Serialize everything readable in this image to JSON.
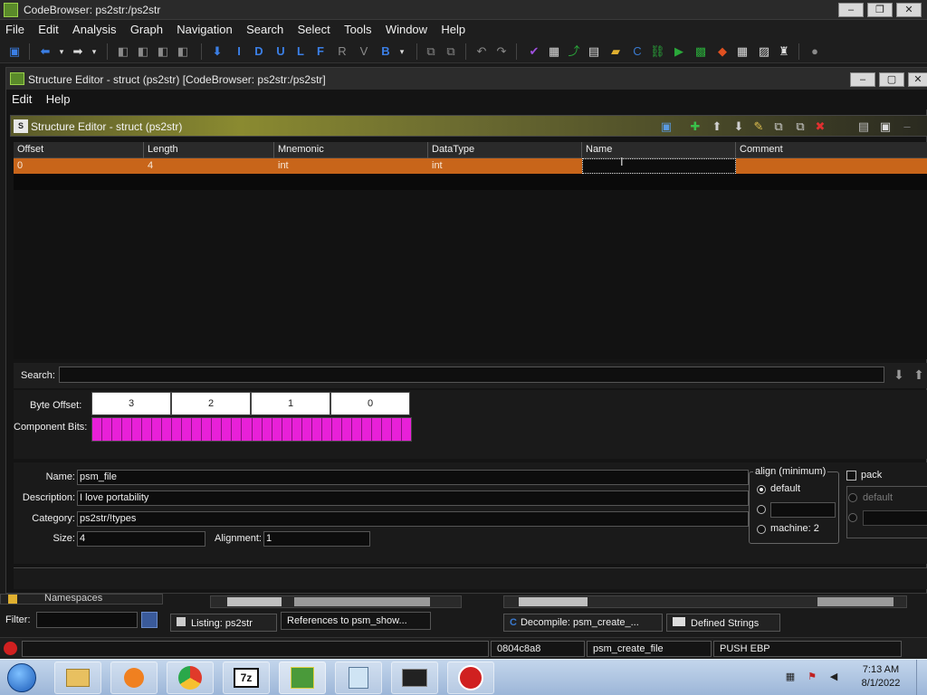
{
  "main_window": {
    "title": "CodeBrowser: ps2str:/ps2str",
    "menu": [
      "File",
      "Edit",
      "Analysis",
      "Graph",
      "Navigation",
      "Search",
      "Select",
      "Tools",
      "Window",
      "Help"
    ],
    "toolbar_letters": [
      "I",
      "D",
      "U",
      "L",
      "F",
      "R",
      "V",
      "B"
    ]
  },
  "structure_editor": {
    "window_title": "Structure Editor - struct (ps2str) [CodeBrowser: ps2str:/ps2str]",
    "menu": [
      "Edit",
      "Help"
    ],
    "header_title": "Structure Editor - struct (ps2str)",
    "header_icon": "S",
    "table": {
      "columns": [
        "Offset",
        "Length",
        "Mnemonic",
        "DataType",
        "Name",
        "Comment"
      ],
      "rows": [
        {
          "offset": "0",
          "length": "4",
          "mnemonic": "int",
          "datatype": "int",
          "name": "",
          "comment": ""
        }
      ]
    },
    "search": {
      "label": "Search:",
      "value": ""
    },
    "bit_editor": {
      "byte_offset_label": "Byte Offset:",
      "component_bits_label": "Component Bits:",
      "bytes": [
        "3",
        "2",
        "1",
        "0"
      ],
      "bits_set": 32
    },
    "form": {
      "name_label": "Name:",
      "name": "psm_file",
      "description_label": "Description:",
      "description": "I love portability",
      "category_label": "Category:",
      "category": "ps2str/!types",
      "size_label": "Size:",
      "size": "4",
      "alignment_label": "Alignment:",
      "alignment": "1"
    },
    "align": {
      "title": "align (minimum)",
      "default_label": "default",
      "machine_label": "machine: 2",
      "selected": "default"
    },
    "pack": {
      "label": "pack",
      "default_label": "default",
      "checked": false
    }
  },
  "lower": {
    "namespaces_label": "Namespaces",
    "filter_label": "Filter:",
    "tabs": [
      "Listing:  ps2str",
      "References to psm_show...",
      "Decompile: psm_create_...",
      "Defined Strings"
    ]
  },
  "statusbar": {
    "address": "0804c8a8",
    "function": "psm_create_file",
    "instruction": "PUSH EBP"
  },
  "taskbar": {
    "time": "7:13 AM",
    "date": "8/1/2022",
    "apps": [
      "file-explorer-icon",
      "media-player-icon",
      "chrome-icon",
      "7zip-icon",
      "ghidra-task-icon",
      "notepad-icon",
      "terminal-icon",
      "ghidra-dragon-icon"
    ]
  },
  "colors": {
    "selected_row": "#c8651a",
    "component_bits": "#e820d8"
  }
}
